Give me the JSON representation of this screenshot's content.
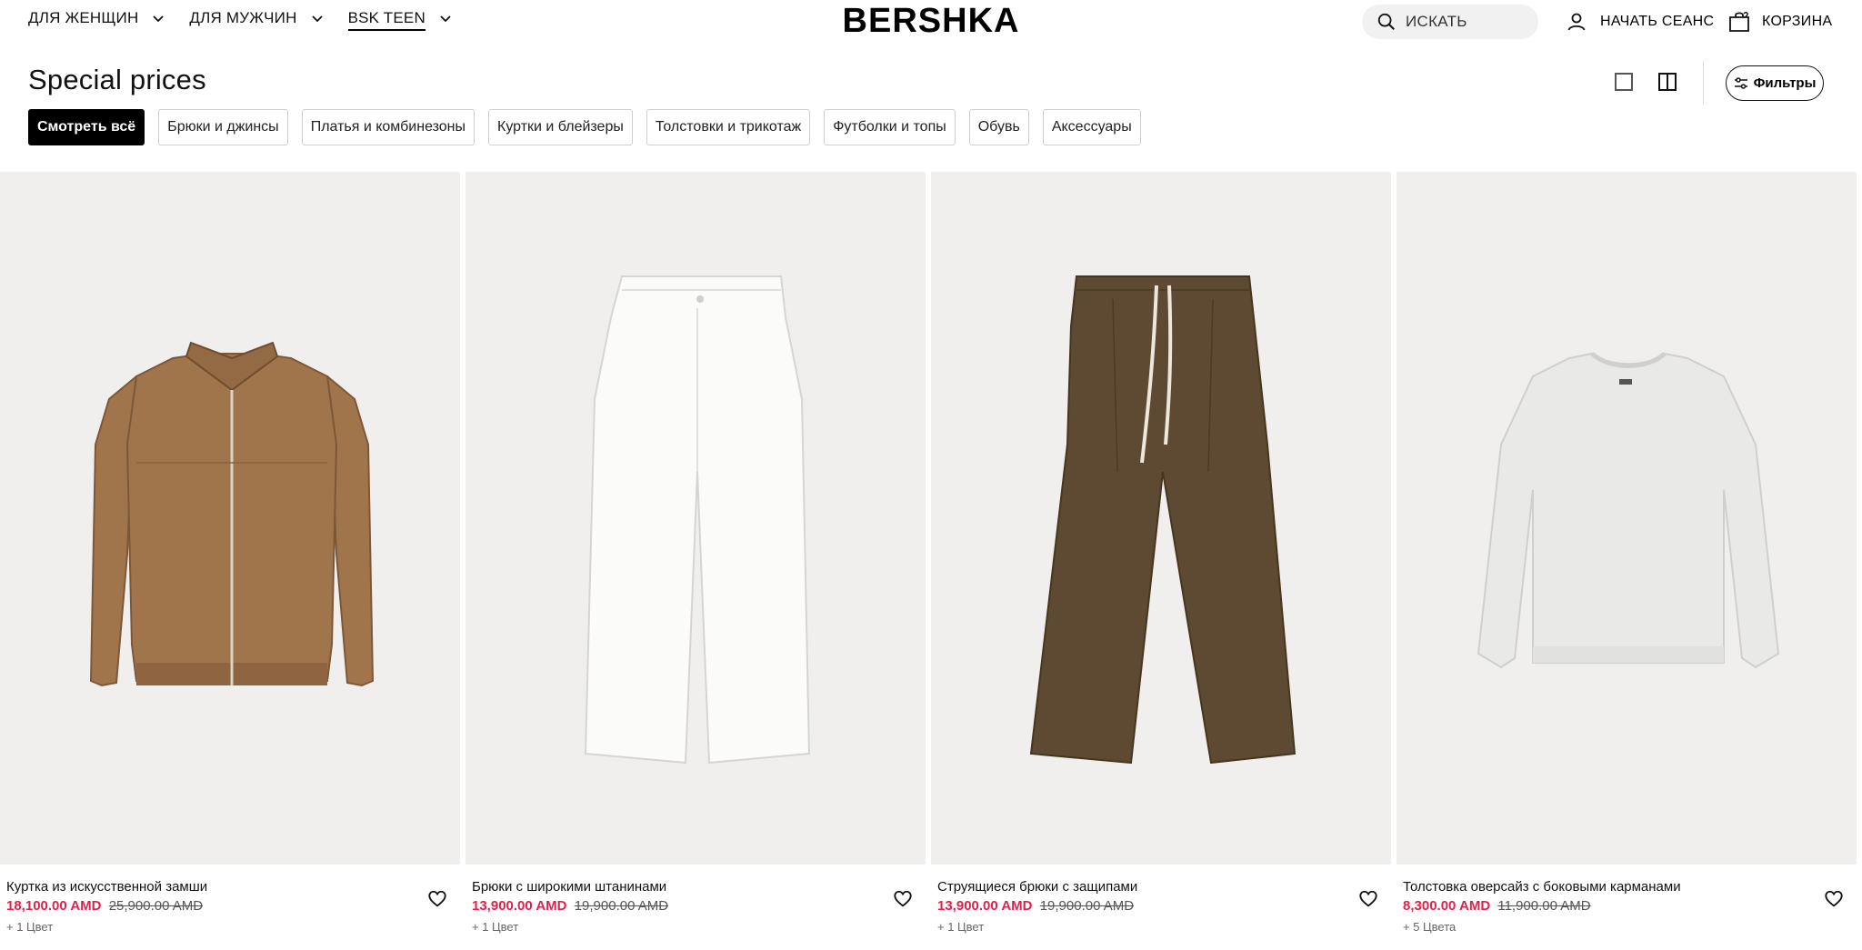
{
  "header": {
    "nav": [
      {
        "label": "ДЛЯ ЖЕНЩИН"
      },
      {
        "label": "ДЛЯ МУЖЧИН"
      },
      {
        "label": "BSK TEEN"
      }
    ],
    "active_nav": "BSK TEEN",
    "logo": "BERSHKA",
    "search_label": "ИСКАТЬ",
    "login_label": "НАЧАТЬ СЕАНС",
    "cart_label": "КОРЗИНА"
  },
  "page": {
    "title": "Special prices",
    "filters_label": "Фильтры"
  },
  "chips": [
    {
      "label": "Смотреть всё",
      "active": true
    },
    {
      "label": "Брюки и джинсы"
    },
    {
      "label": "Платья и комбинезоны"
    },
    {
      "label": "Куртки и блейзеры"
    },
    {
      "label": "Толстовки и трикотаж"
    },
    {
      "label": "Футболки и топы"
    },
    {
      "label": "Обувь"
    },
    {
      "label": "Аксессуары"
    }
  ],
  "products": [
    {
      "name": "Куртка из искусственной замши",
      "price": "18,100.00 AMD",
      "old_price": "25,900.00 AMD",
      "colors": "+ 1 Цвет",
      "color": "#a0754b"
    },
    {
      "name": "Брюки с широкими штанинами",
      "price": "13,900.00 AMD",
      "old_price": "19,900.00 AMD",
      "colors": "+ 1 Цвет",
      "color": "#fbfbf9"
    },
    {
      "name": "Струящиеся брюки с защипами",
      "price": "13,900.00 AMD",
      "old_price": "19,900.00 AMD",
      "colors": "+ 1 Цвет",
      "color": "#5e4a32"
    },
    {
      "name": "Толстовка оверсайз с боковыми карманами",
      "price": "8,300.00 AMD",
      "old_price": "11,900.00 AMD",
      "colors": "+ 5 Цвета",
      "color": "#e9e9e7"
    }
  ],
  "colors": {
    "sale": "#e0224c",
    "image_bg": "#f0efed",
    "chip_active_bg": "#000000"
  }
}
